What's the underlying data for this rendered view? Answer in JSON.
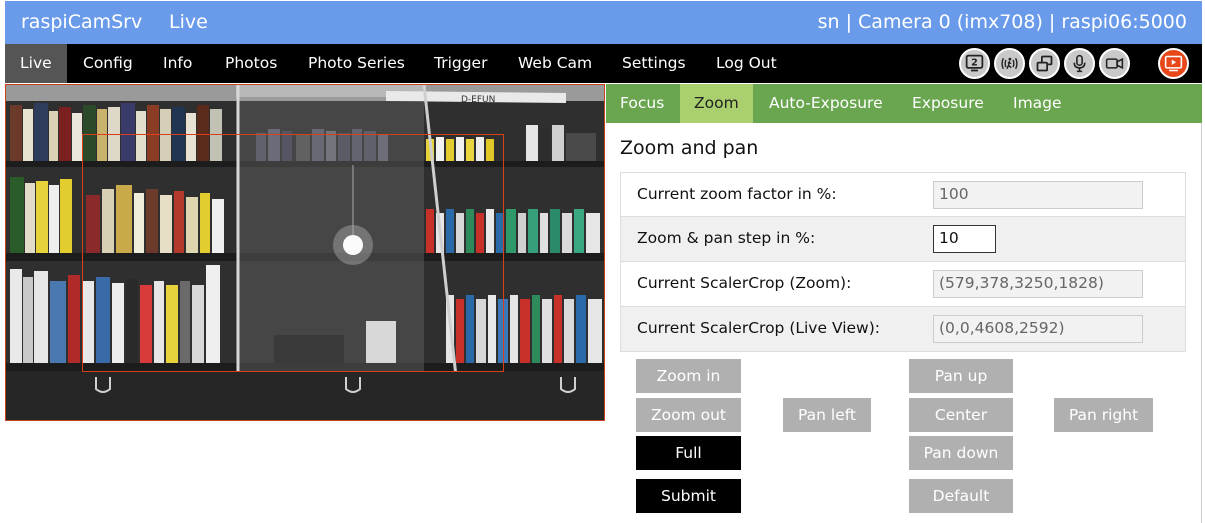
{
  "header": {
    "app_title": "raspiCamSrv",
    "page_name": "Live",
    "server_info": "sn | Camera 0 (imx708) | raspi06:5000"
  },
  "nav": {
    "items": [
      "Live",
      "Config",
      "Info",
      "Photos",
      "Photo Series",
      "Trigger",
      "Web Cam",
      "Settings",
      "Log Out"
    ],
    "icons": [
      "second-camera-icon",
      "motion-detection-icon",
      "multi-window-icon",
      "microphone-icon",
      "video-camera-icon",
      "live-stream-icon"
    ],
    "icon_badge": "2"
  },
  "tabs": [
    "Focus",
    "Zoom",
    "Auto-Exposure",
    "Exposure",
    "Image"
  ],
  "zoom": {
    "title": "Zoom and pan",
    "rows": [
      {
        "label": "Current zoom factor in %:",
        "value": "100"
      },
      {
        "label": "Zoom & pan step in %:",
        "value": "10"
      },
      {
        "label": "Current ScalerCrop (Zoom):",
        "value": "(579,378,3250,1828)"
      },
      {
        "label": "Current ScalerCrop (Live View):",
        "value": "(0,0,4608,2592)"
      }
    ],
    "buttons": {
      "zoom_in": "Zoom in",
      "zoom_out": "Zoom out",
      "full": "Full",
      "submit": "Submit",
      "pan_left": "Pan left",
      "pan_up": "Pan up",
      "center": "Center",
      "pan_down": "Pan down",
      "default": "Default",
      "pan_right": "Pan right"
    }
  },
  "colors": {
    "header_blue": "#6a9bea",
    "tab_green": "#6aa650",
    "tab_active": "#a9cf6e",
    "zoom_frame": "#d8401c",
    "stream_active": "#e8471a"
  }
}
